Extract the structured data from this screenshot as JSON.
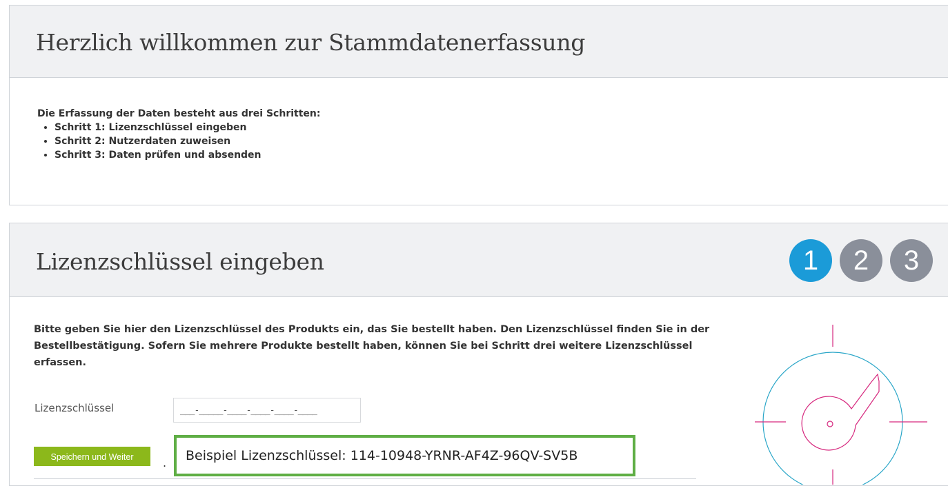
{
  "welcome": {
    "title": "Herzlich willkommen zur Stammdatenerfassung",
    "intro": "Die Erfassung der Daten besteht aus drei Schritten:",
    "steps": [
      "Schritt 1: Lizenzschlüssel eingeben",
      "Schritt 2: Nutzerdaten zuweisen",
      "Schritt 3: Daten prüfen und absenden"
    ]
  },
  "license": {
    "title": "Lizenzschlüssel eingeben",
    "step_indicators": [
      "1",
      "2",
      "3"
    ],
    "active_step": "1",
    "description": "Bitte geben Sie hier den Lizenzschlüssel des Produkts ein, das Sie bestellt haben. Den Lizenzschlüssel finden Sie in der Bestellbestätigung. Sofern Sie mehrere Produkte bestellt haben, können Sie bei Schritt drei weitere Lizenzschlüssel erfassen.",
    "field_label": "Lizenzschlüssel",
    "field_value": "___-_____-____-____-____-____",
    "save_button": "Speichern und Weiter",
    "dot": ".",
    "example": "Beispiel Lizenzschlüssel: 114-10948-YRNR-AF4Z-96QV-SV5B"
  },
  "colors": {
    "active_step": "#1b9bd8",
    "inactive_step": "#8a8f9a",
    "button": "#8cb81b",
    "example_border": "#5fae45",
    "drawing_circle": "#2aa6c8",
    "drawing_key": "#d6287e"
  }
}
